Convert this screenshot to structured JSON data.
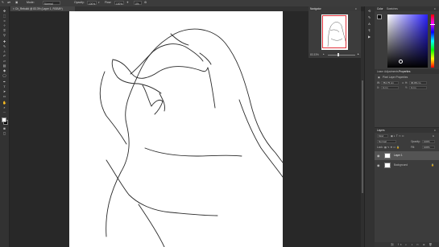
{
  "options_bar": {
    "mode_label": "Mode:",
    "mode_value": "Normal",
    "opacity_label": "Opacity:",
    "opacity_value": "100%",
    "flow_label": "Flow:",
    "flow_value": "100%",
    "smoothing_value": "0%"
  },
  "document": {
    "tab_title": "Ch_Rebuild @ 83.3% (Layer 1, RGB/8*)"
  },
  "navigator": {
    "tabs": [
      "Navigator"
    ],
    "zoom": "83.33%"
  },
  "color_panel": {
    "tabs": [
      "Color",
      "Swatches"
    ],
    "foreground": "#000000",
    "background": "#ffffff"
  },
  "properties_panel": {
    "tabs": [
      "Learn",
      "Adjustments",
      "Properties"
    ],
    "title": "Pixel Layer Properties",
    "w_label": "W:",
    "w_value": "784.75 cm",
    "h_label": "H:",
    "h_value": "96.88 cm",
    "x_label": "X:",
    "x_value": "0 cm",
    "y_label": "Y:",
    "y_value": "0 cm"
  },
  "layers_panel": {
    "tabs": [
      "Layers"
    ],
    "kind_label": "Kind",
    "blend_mode": "Normal",
    "opacity_label": "Opacity:",
    "opacity_value": "100%",
    "lock_label": "Lock:",
    "fill_label": "Fill:",
    "fill_value": "100%",
    "layers": [
      {
        "name": "Layer 1"
      },
      {
        "name": "Background"
      }
    ]
  },
  "tool_icons": [
    "move-icon",
    "marquee-icon",
    "lasso-icon",
    "magic-wand-icon",
    "crop-icon",
    "eyedropper-icon",
    "healing-icon",
    "brush-icon",
    "stamp-icon",
    "history-brush-icon",
    "eraser-icon",
    "gradient-icon",
    "blur-icon",
    "dodge-icon",
    "pen-icon",
    "type-icon",
    "path-select-icon",
    "rectangle-icon",
    "hand-icon",
    "zoom-icon",
    "more-tools-icon"
  ]
}
